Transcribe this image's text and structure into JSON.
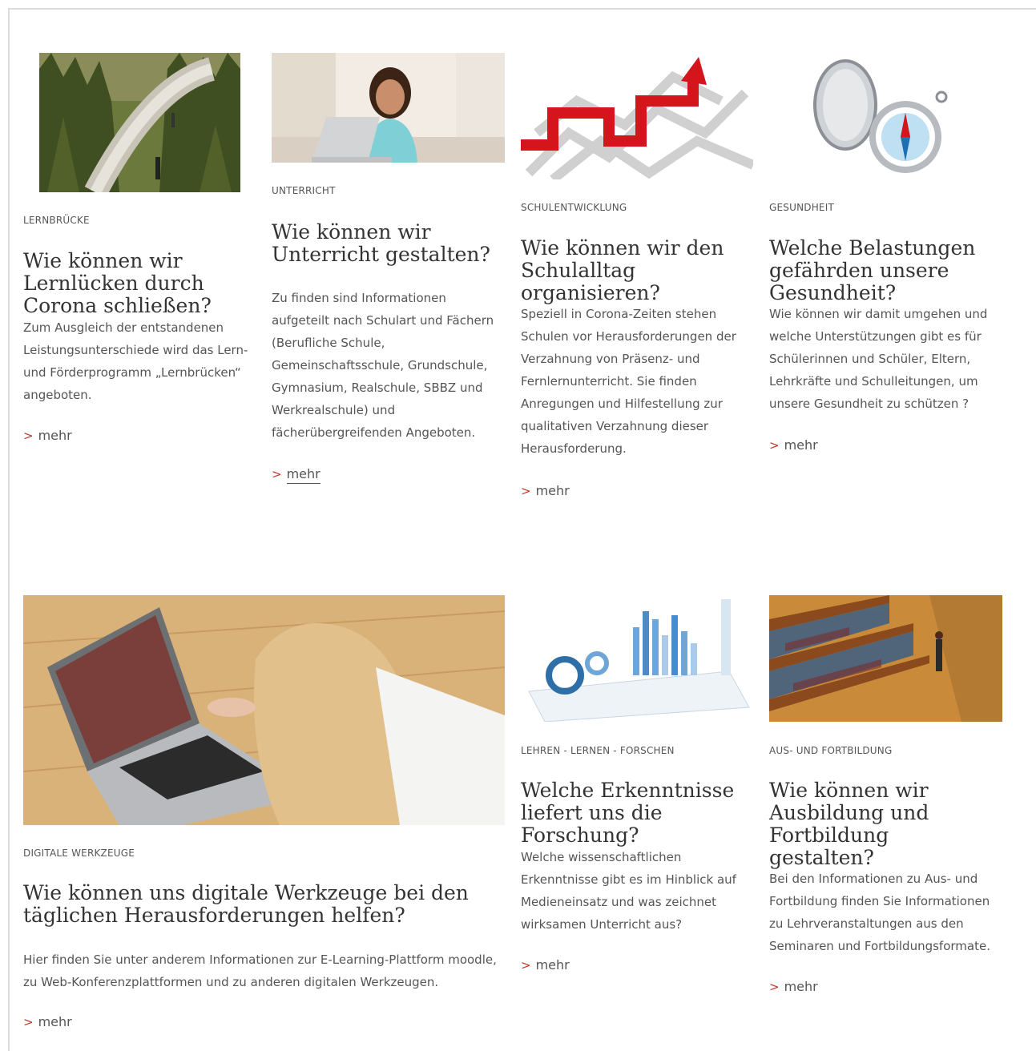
{
  "cards": [
    {
      "category": "Lernbrücke",
      "title": "Wie können wir Lernlücken durch Corona schließen?",
      "text": "Zum Ausgleich der entstandenen Leistungsunterschiede wird das Lern- und Förderprogramm „Lernbrücken“ angeboten.",
      "more": "mehr",
      "image": "bridge-forest-image"
    },
    {
      "category": "Unterricht",
      "title": "Wie können wir Unterricht gestalten?",
      "text": "Zu finden sind Informationen aufgeteilt nach Schulart und Fächern (Berufliche Schule, Gemeinschaftsschule, Grundschule, Gymnasium, Realschule, SBBZ und Werkrealschule) und fächerübergreifenden Angeboten.",
      "more": "mehr",
      "image": "girl-laptop-image"
    },
    {
      "category": "Schulentwicklung",
      "title": "Wie können wir den Schulalltag organisieren?",
      "text": "Speziell in Corona-Zeiten stehen Schulen vor Herausforderungen der Verzahnung von Präsenz- und Fernlernunterricht. Sie finden Anregungen und Hilfestellung zur qualitativen Verzahnung dieser Herausforderung.",
      "more": "mehr",
      "image": "maze-arrow-image"
    },
    {
      "category": "Gesundheit",
      "title": "Welche Belastungen gefährden unsere Gesundheit?",
      "text": "Wie können wir damit umgehen und welche Unterstützungen gibt es für Schülerinnen und Schüler, Eltern, Lehrkräfte und Schulleitungen, um unsere Gesundheit zu schützen ?",
      "more": "mehr",
      "image": "compass-image"
    },
    {
      "category": "Digitale Werkzeuge",
      "title": "Wie können uns digitale Werkzeuge bei den täglichen Herausforderungen helfen?",
      "text": "Hier finden Sie unter anderem Informationen zur E-Learning-Plattform moodle, zu Web-Konferenzplattformen und zu anderen digitalen Werkzeugen.",
      "more": "mehr",
      "image": "girl-floor-laptop-image"
    },
    {
      "category": "Lehren - Lernen - Forschen",
      "title": "Welche Erkenntnisse liefert uns die Forschung?",
      "text": "Welche wissenschaftlichen Erkenntnisse gibt es im Hinblick auf Medieneinsatz und was zeichnet wirksamen Unterricht aus?",
      "more": "mehr",
      "image": "charts-image"
    },
    {
      "category": "Aus- und Fortbildung",
      "title": "Wie können wir Ausbildung und Fortbildung gestalten?",
      "text": "Bei den Informationen zu Aus- und Fortbildung finden Sie Informationen zu Lehrveranstaltungen aus den Seminaren und Fortbildungsformate.",
      "more": "mehr",
      "image": "library-image"
    }
  ],
  "colors": {
    "accent": "#c0392b",
    "text": "#555555",
    "title": "#333333"
  }
}
